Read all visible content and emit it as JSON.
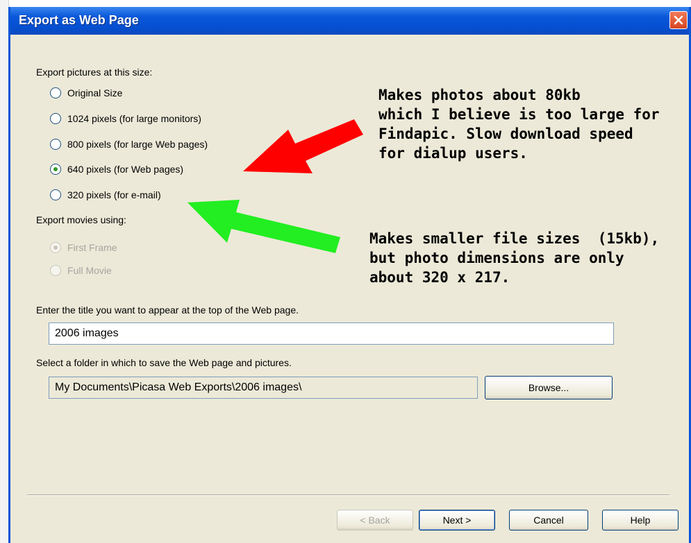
{
  "dialog": {
    "title": "Export as Web Page",
    "close_label": "×"
  },
  "size_section": {
    "label": "Export pictures at this size:",
    "options": [
      {
        "label": "Original Size",
        "selected": false
      },
      {
        "label": "1024 pixels (for large monitors)",
        "selected": false
      },
      {
        "label": "800 pixels (for large Web pages)",
        "selected": false
      },
      {
        "label": "640 pixels (for Web pages)",
        "selected": true
      },
      {
        "label": "320 pixels (for e-mail)",
        "selected": false
      }
    ]
  },
  "movie_section": {
    "label": "Export movies using:",
    "options": [
      {
        "label": "First Frame",
        "selected": true,
        "disabled": true
      },
      {
        "label": "Full Movie",
        "selected": false,
        "disabled": true
      }
    ]
  },
  "title_field": {
    "label": "Enter the title you want to appear at the top of the Web page.",
    "value": "2006 images"
  },
  "folder_field": {
    "label": "Select a folder in which to save the Web page and pictures.",
    "value": "My Documents\\Picasa Web Exports\\2006 images\\",
    "browse_label": "Browse..."
  },
  "footer": {
    "back_label": "< Back",
    "next_label": "Next >",
    "cancel_label": "Cancel",
    "help_label": "Help"
  },
  "annotations": {
    "red_note": "Makes photos about 80kb\nwhich I believe is too large for\nFindapic. Slow download speed\nfor dialup users.",
    "green_note": "Makes smaller file sizes  (15kb),\nbut photo dimensions are only\nabout 320 x 217."
  },
  "colors": {
    "title_bar": "#0550d2",
    "dialog_bg": "#ece9d8",
    "red_arrow": "#ff0000",
    "green_arrow": "#22ee22"
  }
}
